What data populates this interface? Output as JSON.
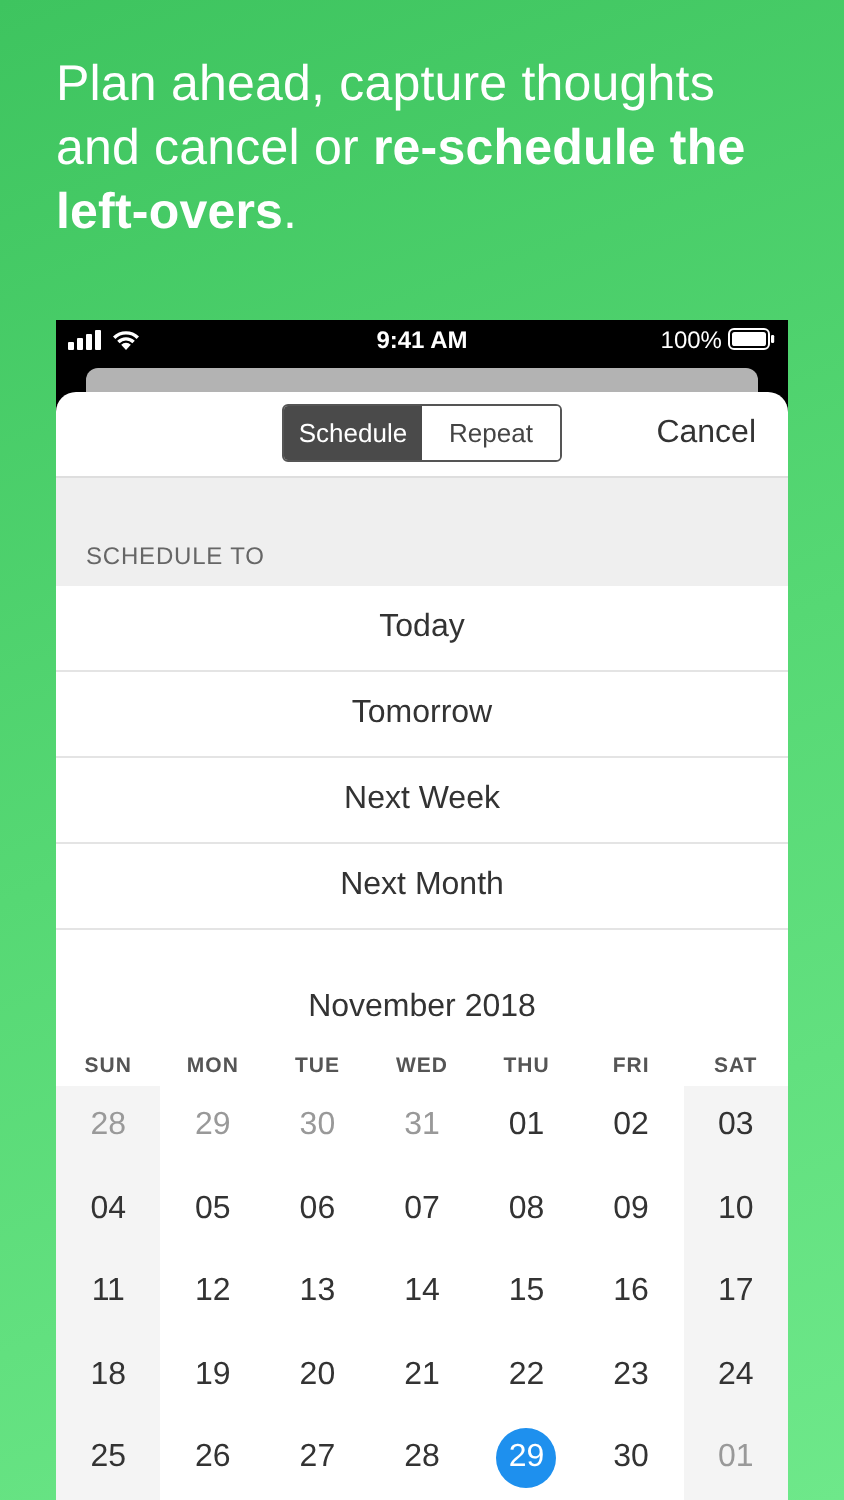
{
  "headline": "Plan ahead, capture thoughts and cancel or **re-schedule the left-overs**.",
  "status_bar": {
    "time": "9:41 AM",
    "battery": "100%"
  },
  "segments": [
    {
      "label": "Schedule",
      "selected": true
    },
    {
      "label": "Repeat",
      "selected": false
    }
  ],
  "cancel": "Cancel",
  "section_header": "SCHEDULE TO",
  "options": [
    "Today",
    "Tomorrow",
    "Next Week",
    "Next Month"
  ],
  "calendar": {
    "month": "November 2018",
    "weekdays": [
      "SUN",
      "MON",
      "TUE",
      "WED",
      "THU",
      "FRI",
      "SAT"
    ],
    "weeks": [
      [
        {
          "day": "28",
          "in_month": false,
          "selected": false
        },
        {
          "day": "29",
          "in_month": false,
          "selected": false
        },
        {
          "day": "30",
          "in_month": false,
          "selected": false
        },
        {
          "day": "31",
          "in_month": false,
          "selected": false
        },
        {
          "day": "01",
          "in_month": true,
          "selected": false
        },
        {
          "day": "02",
          "in_month": true,
          "selected": false
        },
        {
          "day": "03",
          "in_month": true,
          "selected": false
        }
      ],
      [
        {
          "day": "04",
          "in_month": true,
          "selected": false
        },
        {
          "day": "05",
          "in_month": true,
          "selected": false
        },
        {
          "day": "06",
          "in_month": true,
          "selected": false
        },
        {
          "day": "07",
          "in_month": true,
          "selected": false
        },
        {
          "day": "08",
          "in_month": true,
          "selected": false
        },
        {
          "day": "09",
          "in_month": true,
          "selected": false
        },
        {
          "day": "10",
          "in_month": true,
          "selected": false
        }
      ],
      [
        {
          "day": "11",
          "in_month": true,
          "selected": false
        },
        {
          "day": "12",
          "in_month": true,
          "selected": false
        },
        {
          "day": "13",
          "in_month": true,
          "selected": false
        },
        {
          "day": "14",
          "in_month": true,
          "selected": false
        },
        {
          "day": "15",
          "in_month": true,
          "selected": false
        },
        {
          "day": "16",
          "in_month": true,
          "selected": false
        },
        {
          "day": "17",
          "in_month": true,
          "selected": false
        }
      ],
      [
        {
          "day": "18",
          "in_month": true,
          "selected": false
        },
        {
          "day": "19",
          "in_month": true,
          "selected": false
        },
        {
          "day": "20",
          "in_month": true,
          "selected": false
        },
        {
          "day": "21",
          "in_month": true,
          "selected": false
        },
        {
          "day": "22",
          "in_month": true,
          "selected": false
        },
        {
          "day": "23",
          "in_month": true,
          "selected": false
        },
        {
          "day": "24",
          "in_month": true,
          "selected": false
        }
      ],
      [
        {
          "day": "25",
          "in_month": true,
          "selected": false
        },
        {
          "day": "26",
          "in_month": true,
          "selected": false
        },
        {
          "day": "27",
          "in_month": true,
          "selected": false
        },
        {
          "day": "28",
          "in_month": true,
          "selected": false
        },
        {
          "day": "29",
          "in_month": true,
          "selected": true
        },
        {
          "day": "30",
          "in_month": true,
          "selected": false
        },
        {
          "day": "01",
          "in_month": false,
          "selected": false
        }
      ]
    ]
  }
}
